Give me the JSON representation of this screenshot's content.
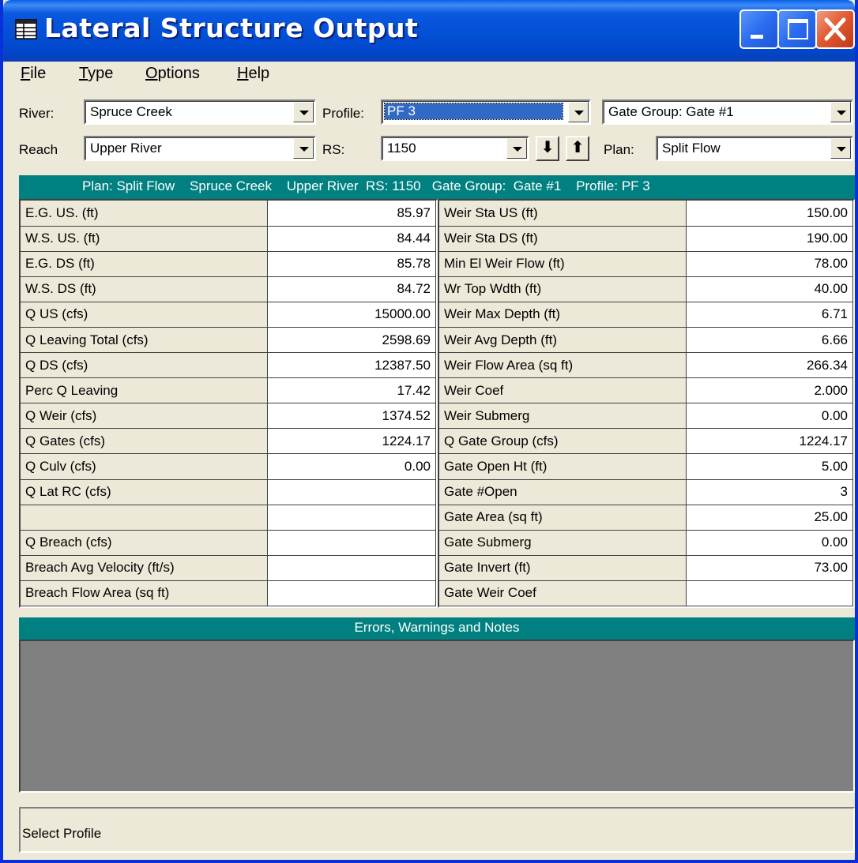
{
  "window": {
    "title": "Lateral Structure Output"
  },
  "menu": {
    "items": [
      {
        "acc": "F",
        "rest": "ile"
      },
      {
        "acc": "T",
        "rest": "ype"
      },
      {
        "acc": "O",
        "rest": "ptions"
      },
      {
        "acc": "H",
        "rest": "elp"
      }
    ]
  },
  "selectors": {
    "river_label": "River:",
    "river_value": "Spruce Creek",
    "profile_label": "Profile:",
    "profile_value": "PF 3",
    "gate_group_value": "Gate Group:  Gate #1",
    "reach_label": "Reach",
    "reach_value": "Upper River",
    "rs_label": "RS:",
    "rs_value": "1150",
    "down_glyph": "⬇",
    "up_glyph": "⬆",
    "plan_label": "Plan:",
    "plan_value": "Split Flow"
  },
  "header": {
    "text": "Plan: Split Flow    Spruce Creek    Upper River  RS: 1150   Gate Group:  Gate #1    Profile: PF 3"
  },
  "left_table": [
    {
      "label": "E.G. US. (ft)",
      "value": "85.97"
    },
    {
      "label": "W.S. US. (ft)",
      "value": "84.44"
    },
    {
      "label": "E.G. DS (ft)",
      "value": "85.78"
    },
    {
      "label": "W.S. DS (ft)",
      "value": "84.72"
    },
    {
      "label": "Q US (cfs)",
      "value": "15000.00"
    },
    {
      "label": "Q Leaving Total (cfs)",
      "value": "2598.69"
    },
    {
      "label": "Q DS (cfs)",
      "value": "12387.50"
    },
    {
      "label": "Perc Q Leaving",
      "value": "17.42"
    },
    {
      "label": "Q Weir (cfs)",
      "value": "1374.52"
    },
    {
      "label": "Q Gates (cfs)",
      "value": "1224.17"
    },
    {
      "label": "Q Culv (cfs)",
      "value": "0.00"
    },
    {
      "label": "Q Lat RC (cfs)",
      "value": ""
    },
    {
      "label": "",
      "value": ""
    },
    {
      "label": "Q Breach (cfs)",
      "value": ""
    },
    {
      "label": "Breach Avg Velocity (ft/s)",
      "value": ""
    },
    {
      "label": "Breach Flow Area (sq ft)",
      "value": ""
    }
  ],
  "right_table": [
    {
      "label": "Weir Sta US (ft)",
      "value": "150.00"
    },
    {
      "label": "Weir Sta DS (ft)",
      "value": "190.00"
    },
    {
      "label": "Min El Weir Flow (ft)",
      "value": "78.00"
    },
    {
      "label": "Wr Top Wdth (ft)",
      "value": "40.00"
    },
    {
      "label": "Weir Max Depth (ft)",
      "value": "6.71"
    },
    {
      "label": "Weir Avg Depth (ft)",
      "value": "6.66"
    },
    {
      "label": "Weir Flow Area (sq ft)",
      "value": "266.34"
    },
    {
      "label": "Weir Coef",
      "value": "2.000"
    },
    {
      "label": "Weir Submerg",
      "value": "0.00"
    },
    {
      "label": "Q Gate Group (cfs)",
      "value": "1224.17"
    },
    {
      "label": "Gate Open Ht (ft)",
      "value": "5.00"
    },
    {
      "label": "Gate #Open",
      "value": "3"
    },
    {
      "label": "Gate Area (sq ft)",
      "value": "25.00"
    },
    {
      "label": "Gate Submerg",
      "value": "0.00"
    },
    {
      "label": "Gate Invert (ft)",
      "value": "73.00"
    },
    {
      "label": "Gate Weir Coef",
      "value": ""
    }
  ],
  "errors": {
    "title": "Errors, Warnings and Notes"
  },
  "status": {
    "text": "Select Profile"
  },
  "colors": {
    "teal": "#008080",
    "window_blue": "#0831d9",
    "face": "#ece9d8"
  }
}
